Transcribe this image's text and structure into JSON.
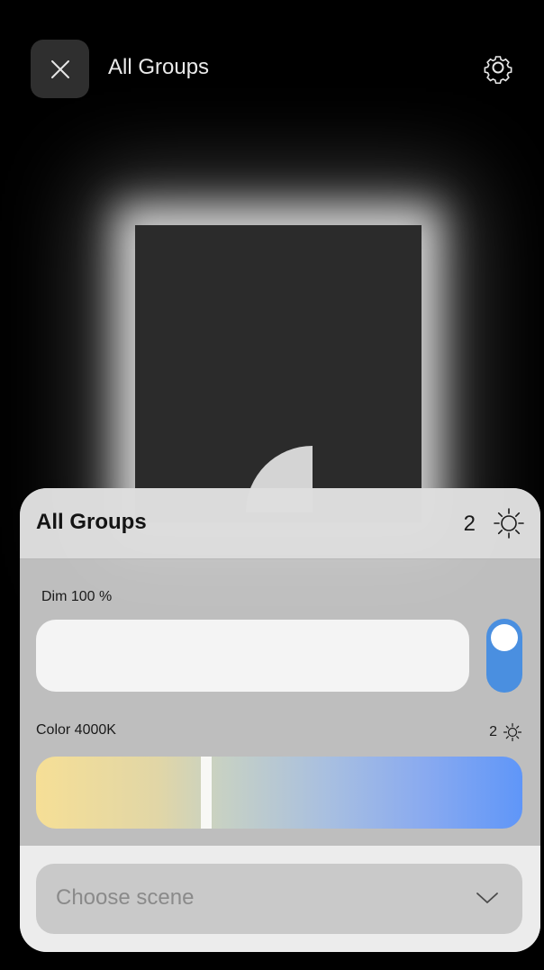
{
  "header": {
    "title": "All Groups"
  },
  "panel": {
    "title": "All Groups",
    "light_count": "2",
    "dim": {
      "label": "Dim 100 %",
      "value_percent": 100,
      "toggle_on": true
    },
    "color": {
      "label": "Color 4000K",
      "light_count": "2",
      "slider_position": 0.35
    },
    "scene": {
      "placeholder": "Choose scene"
    }
  },
  "colors": {
    "accent": "#4a8fe0",
    "warm": "#f6df96",
    "cool": "#5f96f8"
  },
  "icons": [
    "close-icon",
    "gear-icon",
    "sun-icon",
    "chevron-down-icon"
  ]
}
